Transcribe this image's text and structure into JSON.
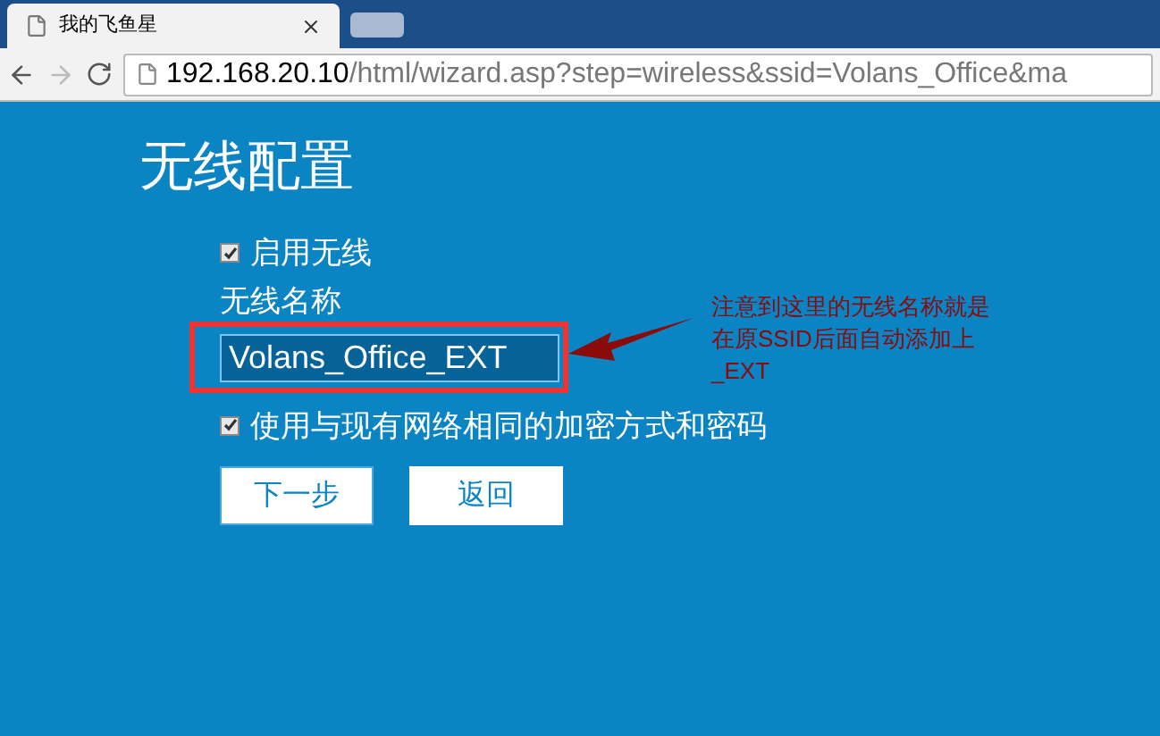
{
  "browser": {
    "tab_title": "我的飞鱼星",
    "url_host": "192.168.20.10",
    "url_path": "/html/wizard.asp?step=wireless&ssid=Volans_Office&ma"
  },
  "page": {
    "title": "无线配置",
    "enable_wireless": {
      "label": "启用无线",
      "checked": true
    },
    "ssid": {
      "label": "无线名称",
      "value": "Volans_Office_EXT"
    },
    "same_security": {
      "label": "使用与现有网络相同的加密方式和密码",
      "checked": true
    },
    "buttons": [
      {
        "label": "下一步",
        "focused": true
      },
      {
        "label": "返回",
        "focused": false
      }
    ]
  },
  "annotation": {
    "lines": [
      "注意到这里的无线名称就是",
      "在原SSID后面自动添加上",
      "_EXT"
    ]
  }
}
